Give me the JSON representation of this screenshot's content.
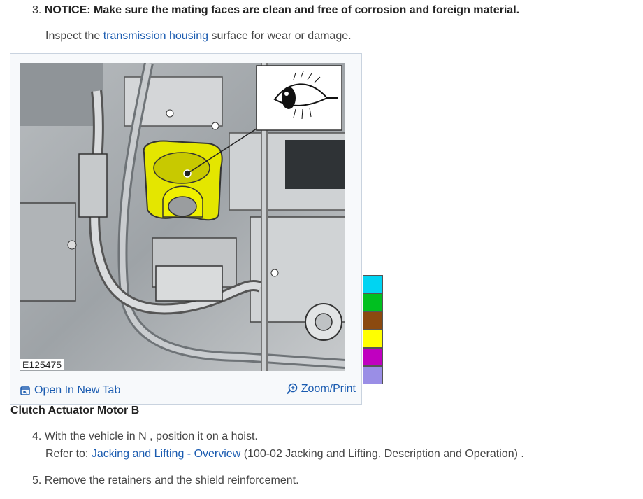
{
  "step3": {
    "number": "3.",
    "notice": "NOTICE: Make sure the mating faces are clean and free of corrosion and foreign material.",
    "inspect_prefix": "Inspect the ",
    "inspect_link": "transmission housing",
    "inspect_suffix": " surface for wear or damage."
  },
  "figure": {
    "id": "E125475",
    "open_tab_label": "Open In New Tab",
    "zoom_print_label": "Zoom/Print",
    "caption": "Clutch Actuator Motor B",
    "highlight_color": "#e4e600"
  },
  "swatches": [
    "#00d4f2",
    "#00c020",
    "#8b4a10",
    "#ffff00",
    "#c000c0",
    "#9a8ee6"
  ],
  "step4": {
    "text": "4. With the vehicle in N , position it on a hoist.",
    "refer_prefix": "Refer to: ",
    "refer_link": "Jacking and Lifting - Overview",
    "refer_suffix": " (100-02 Jacking and Lifting, Description and Operation) ."
  },
  "step5": {
    "text": "5. Remove the retainers and the shield reinforcement."
  }
}
